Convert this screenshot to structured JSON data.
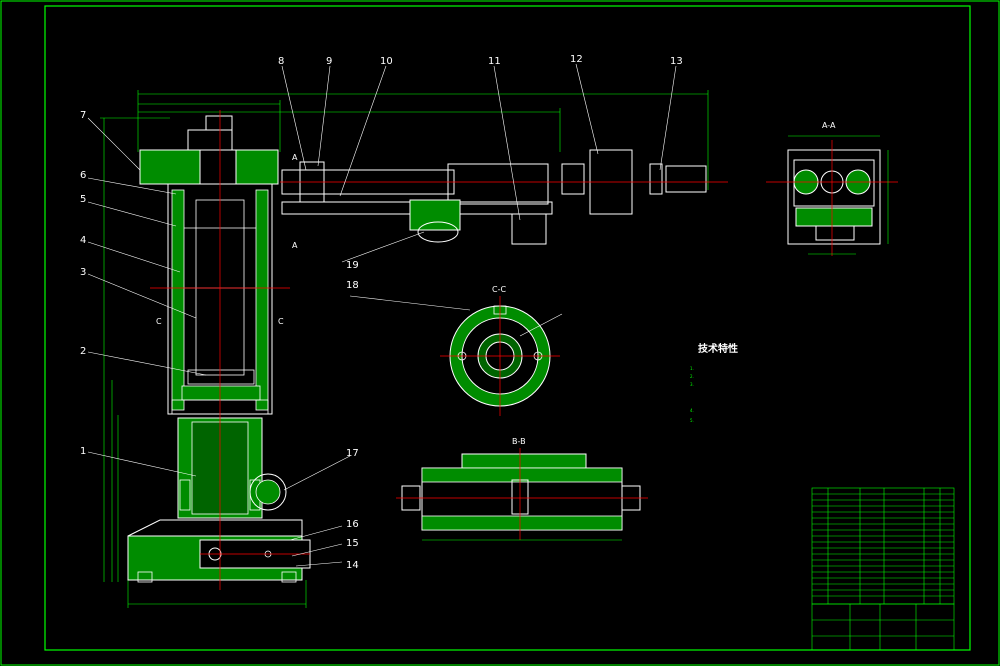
{
  "colors": {
    "background": "#000000",
    "outline": "#ffffff",
    "hatch": "#00ff00",
    "centerline": "#ff0000",
    "dimension": "#00ff00",
    "frame": "#00ff00"
  },
  "part_labels": [
    "1",
    "2",
    "3",
    "4",
    "5",
    "6",
    "7",
    "8",
    "9",
    "10",
    "11",
    "12",
    "13",
    "14",
    "15",
    "16",
    "17",
    "18",
    "19"
  ],
  "section_labels": {
    "aa_view": "A-A",
    "cc_view": "C-C",
    "bb_view": "B-B",
    "a_top": "A",
    "a_bottom": "A",
    "c_left": "C",
    "c_right": "C"
  },
  "technical_requirements": {
    "title": "技术特性",
    "notes": [
      "1.",
      "2.",
      "3.",
      "",
      "",
      "4.",
      "5."
    ]
  },
  "dimensions": {
    "top_overall": "",
    "top_left": "",
    "bottom_base": "",
    "height_left": "",
    "bb_width": "",
    "aa_height": ""
  },
  "title_block": {
    "drawing_number": "",
    "scale": "",
    "sheet": ""
  }
}
